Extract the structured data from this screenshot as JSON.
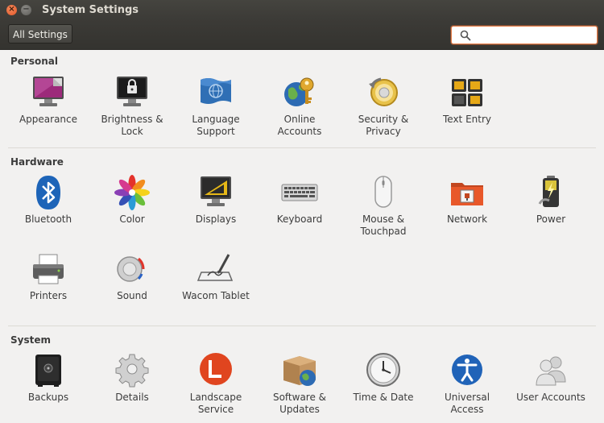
{
  "window": {
    "title": "System Settings",
    "close_glyph": "×",
    "minimize_glyph": "−"
  },
  "toolbar": {
    "all_settings_label": "All Settings",
    "search_value": "",
    "search_placeholder": ""
  },
  "sections": {
    "personal": {
      "title": "Personal",
      "items": [
        {
          "label": "Appearance",
          "icon": "appearance-icon"
        },
        {
          "label": "Brightness &\nLock",
          "icon": "brightness-lock-icon"
        },
        {
          "label": "Language\nSupport",
          "icon": "language-icon"
        },
        {
          "label": "Online\nAccounts",
          "icon": "online-accounts-icon"
        },
        {
          "label": "Security &\nPrivacy",
          "icon": "security-icon"
        },
        {
          "label": "Text Entry",
          "icon": "text-entry-icon"
        }
      ]
    },
    "hardware": {
      "title": "Hardware",
      "items": [
        {
          "label": "Bluetooth",
          "icon": "bluetooth-icon"
        },
        {
          "label": "Color",
          "icon": "color-icon"
        },
        {
          "label": "Displays",
          "icon": "displays-icon"
        },
        {
          "label": "Keyboard",
          "icon": "keyboard-icon"
        },
        {
          "label": "Mouse &\nTouchpad",
          "icon": "mouse-icon"
        },
        {
          "label": "Network",
          "icon": "network-icon"
        },
        {
          "label": "Power",
          "icon": "power-icon"
        },
        {
          "label": "Printers",
          "icon": "printer-icon"
        },
        {
          "label": "Sound",
          "icon": "sound-icon"
        },
        {
          "label": "Wacom Tablet",
          "icon": "wacom-tablet-icon"
        }
      ]
    },
    "system": {
      "title": "System",
      "items": [
        {
          "label": "Backups",
          "icon": "backups-icon"
        },
        {
          "label": "Details",
          "icon": "details-icon"
        },
        {
          "label": "Landscape\nService",
          "icon": "landscape-icon"
        },
        {
          "label": "Software &\nUpdates",
          "icon": "software-updates-icon"
        },
        {
          "label": "Time & Date",
          "icon": "clock-icon"
        },
        {
          "label": "Universal\nAccess",
          "icon": "universal-access-icon"
        },
        {
          "label": "User Accounts",
          "icon": "user-accounts-icon"
        }
      ]
    }
  },
  "colors": {
    "window_bg": "#f2f1f0",
    "titlebar_bg": "#3c3b37",
    "close_button": "#e4572b",
    "search_focus": "#e47b45"
  }
}
